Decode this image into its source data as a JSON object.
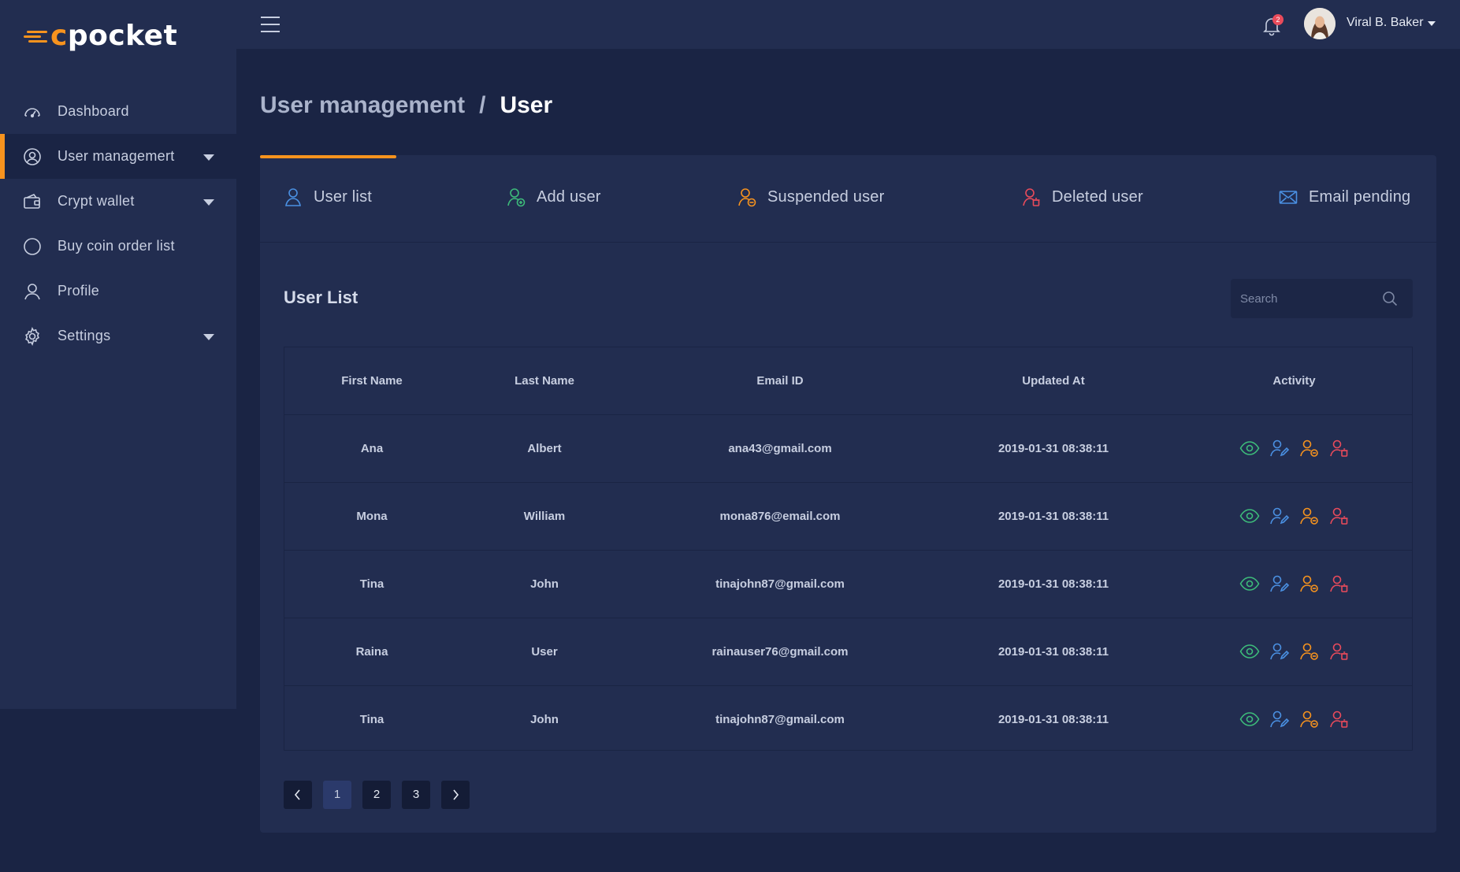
{
  "brand": {
    "logo_prefix": "c",
    "logo_text": "pocket"
  },
  "sidebar": {
    "items": [
      {
        "label": "Dashboard",
        "icon": "dashboard-icon",
        "active": false,
        "has_caret": false
      },
      {
        "label": "User managemert",
        "icon": "user-circle-icon",
        "active": true,
        "has_caret": true
      },
      {
        "label": "Crypt wallet",
        "icon": "wallet-icon",
        "active": false,
        "has_caret": true
      },
      {
        "label": "Buy coin order list",
        "icon": "circle-icon",
        "active": false,
        "has_caret": false
      },
      {
        "label": "Profile",
        "icon": "user-icon",
        "active": false,
        "has_caret": false
      },
      {
        "label": "Settings",
        "icon": "gear-icon",
        "active": false,
        "has_caret": true
      }
    ]
  },
  "topbar": {
    "notification_count": "2",
    "user_name": "Viral B. Baker"
  },
  "breadcrumb": {
    "parent": "User management",
    "separator": "/",
    "current": "User"
  },
  "tabs": [
    {
      "label": "User list",
      "icon": "user-icon",
      "color": "#4a90e2",
      "active": true
    },
    {
      "label": "Add user",
      "icon": "add-user-icon",
      "color": "#3dbb7a",
      "active": false
    },
    {
      "label": "Suspended user",
      "icon": "suspended-user-icon",
      "color": "#f7931e",
      "active": false
    },
    {
      "label": "Deleted user",
      "icon": "deleted-user-icon",
      "color": "#e94b5b",
      "active": false
    },
    {
      "label": "Email pending",
      "icon": "mail-icon",
      "color": "#4a90e2",
      "active": false
    }
  ],
  "user_list": {
    "title": "User List",
    "search_placeholder": "Search",
    "columns": [
      "First Name",
      "Last Name",
      "Email ID",
      "Updated At",
      "Activity"
    ],
    "rows": [
      {
        "first": "Ana",
        "last": "Albert",
        "email": "ana43@gmail.com",
        "updated": "2019-01-31 08:38:11"
      },
      {
        "first": "Mona",
        "last": "William",
        "email": "mona876@email.com",
        "updated": "2019-01-31 08:38:11"
      },
      {
        "first": "Tina",
        "last": "John",
        "email": "tinajohn87@gmail.com",
        "updated": "2019-01-31 08:38:11"
      },
      {
        "first": "Raina",
        "last": "User",
        "email": "rainauser76@gmail.com",
        "updated": "2019-01-31 08:38:11"
      },
      {
        "first": "Tina",
        "last": "John",
        "email": "tinajohn87@gmail.com",
        "updated": "2019-01-31 08:38:11"
      }
    ],
    "activity_icons": [
      {
        "name": "view-icon",
        "color": "#3dbb7a"
      },
      {
        "name": "edit-user-icon",
        "color": "#4a90e2"
      },
      {
        "name": "suspend-user-icon",
        "color": "#f7931e"
      },
      {
        "name": "delete-user-icon",
        "color": "#e94b5b"
      }
    ]
  },
  "pagination": {
    "pages": [
      "1",
      "2",
      "3"
    ],
    "current": "1"
  },
  "colors": {
    "accent": "#f7931e",
    "background": "#1a2444",
    "panel": "#222d50",
    "success": "#3dbb7a",
    "info": "#4a90e2",
    "danger": "#e94b5b"
  }
}
